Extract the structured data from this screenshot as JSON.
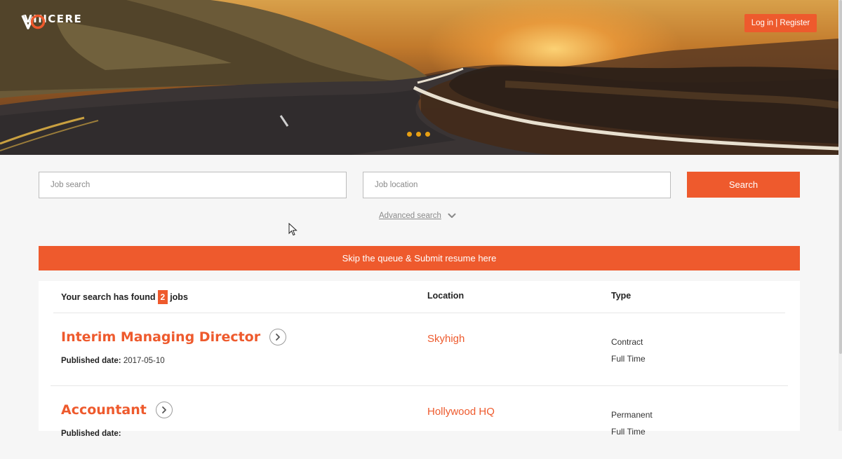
{
  "header": {
    "brand": "VINCERE",
    "login_label": "Log in | Register",
    "slides_count": 3
  },
  "search": {
    "job_placeholder": "Job search",
    "location_placeholder": "Job location",
    "button_label": "Search",
    "advanced_label": "Advanced search"
  },
  "banner": {
    "label": "Skip the queue & Submit resume here"
  },
  "results": {
    "found_prefix": "Your search has found",
    "count": "2",
    "found_suffix": "jobs",
    "location_header": "Location",
    "type_header": "Type",
    "published_label": "Published date:",
    "jobs": [
      {
        "title": "Interim Managing Director",
        "published_date": "2017-05-10",
        "location": "Skyhigh",
        "types": [
          "Contract",
          "Full Time"
        ]
      },
      {
        "title": "Accountant",
        "published_date": "",
        "location": "Hollywood HQ",
        "types": [
          "Permanent",
          "Full Time"
        ]
      }
    ]
  },
  "colors": {
    "accent": "#ee5a2d",
    "dot": "#e8a013",
    "background": "#f6f6f6"
  },
  "icons": {
    "logo": "vincere-logo-icon",
    "advanced_toggle": "chevron-down-icon",
    "job_link": "chevron-right-circle-icon",
    "pointer": "mouse-cursor-icon"
  }
}
